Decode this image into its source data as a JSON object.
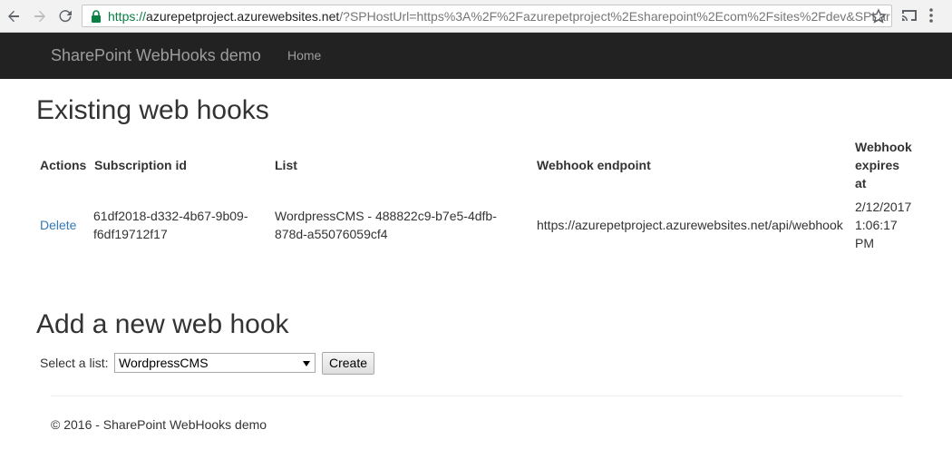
{
  "browser": {
    "url_scheme": "https://",
    "url_host": "azurepetproject.azurewebsites.net",
    "url_rest": "/?SPHostUrl=https%3A%2F%2Fazurepetproject%2Esharepoint%2Ecom%2Fsites%2Fdev&SPLar",
    "secure_color": "#0b8043"
  },
  "navbar": {
    "brand": "SharePoint WebHooks demo",
    "home": "Home",
    "background": "#222222"
  },
  "existing": {
    "heading": "Existing web hooks",
    "columns": {
      "actions": "Actions",
      "subscription": "Subscription id",
      "list": "List",
      "endpoint": "Webhook endpoint",
      "expires_1": "Webhook",
      "expires_2": "expires",
      "expires_3": "at"
    },
    "rows": [
      {
        "action": "Delete",
        "subscription_1": "61df2018-d332-4b67-9b09-",
        "subscription_2": "f6df19712f17",
        "list_1": "WordpressCMS - 488822c9-b7e5-4dfb-",
        "list_2": "878d-a55076059cf4",
        "endpoint": "https://azurepetproject.azurewebsites.net/api/webhook",
        "expires_1": "2/12/2017",
        "expires_2": "1:06:17",
        "expires_3": "PM"
      }
    ]
  },
  "add": {
    "heading": "Add a new web hook",
    "select_label": "Select a list:",
    "selected_list": "WordpressCMS",
    "create_label": "Create"
  },
  "footer": {
    "text": "© 2016 - SharePoint WebHooks demo"
  },
  "colors": {
    "link": "#337ab7",
    "text": "#333333"
  }
}
